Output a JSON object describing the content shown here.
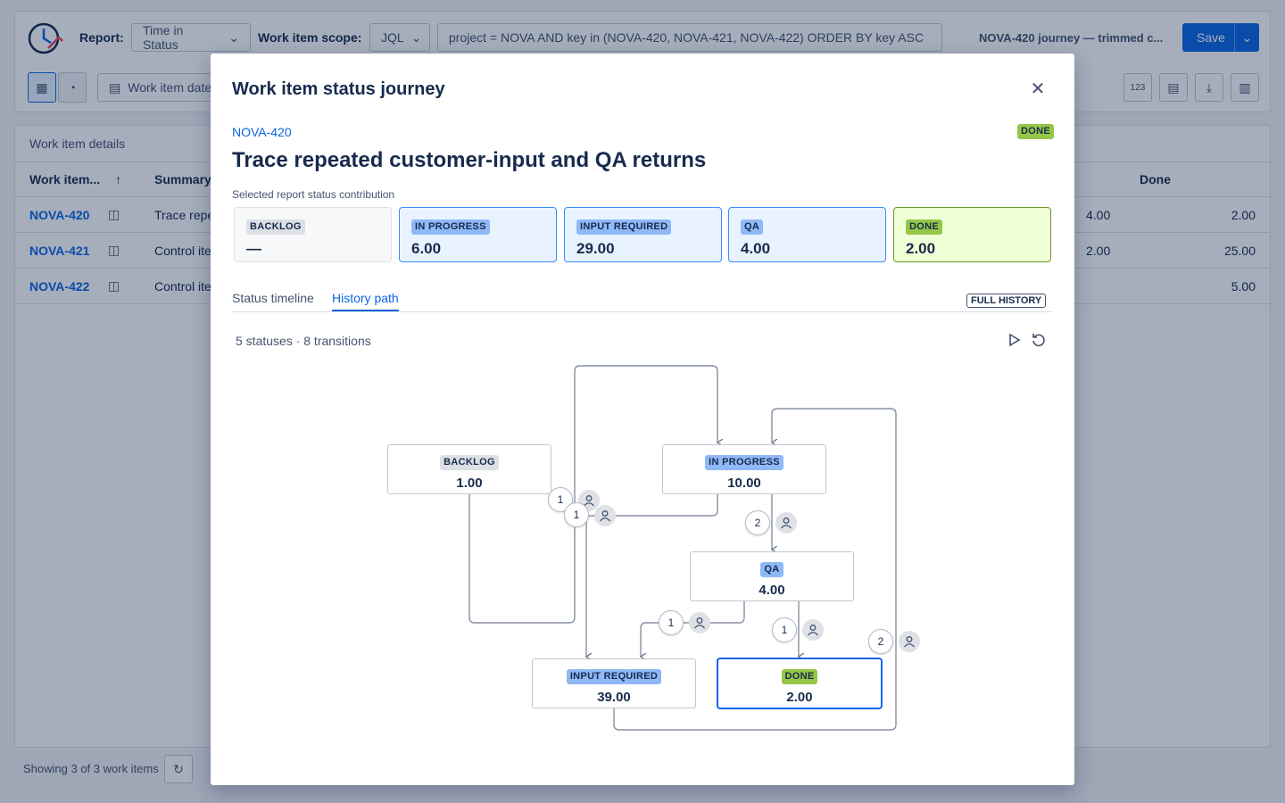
{
  "toolbar": {
    "report_label": "Report:",
    "report_value": "Time in Status",
    "scope_label": "Work item scope:",
    "scope_value": "JQL",
    "jql": "project = NOVA AND key in (NOVA-420, NOVA-421, NOVA-422) ORDER BY key ASC",
    "report_name": "NOVA-420 journey — trimmed c...",
    "save_label": "Save",
    "date_filter_label": "Work item date",
    "numbers_icon_label": "123"
  },
  "table": {
    "title": "Work item details",
    "col_key": "Work item...",
    "col_summary": "Summary",
    "col_done": "Done",
    "rows": [
      {
        "key": "NOVA-420",
        "summary": "Trace repe",
        "qa": "4.00",
        "done": "2.00"
      },
      {
        "key": "NOVA-421",
        "summary": "Control ite",
        "qa": "2.00",
        "done": "25.00"
      },
      {
        "key": "NOVA-422",
        "summary": "Control ite",
        "qa": "-",
        "done": "5.00"
      }
    ],
    "footer": "Showing 3 of 3 work items"
  },
  "modal": {
    "title": "Work item status journey",
    "key": "NOVA-420",
    "status": "DONE",
    "summary": "Trace repeated customer-input and QA returns",
    "contrib_label": "Selected report status contribution",
    "contrib": [
      {
        "name": "BACKLOG",
        "value": "—"
      },
      {
        "name": "IN PROGRESS",
        "value": "6.00"
      },
      {
        "name": "INPUT REQUIRED",
        "value": "29.00"
      },
      {
        "name": "QA",
        "value": "4.00"
      },
      {
        "name": "DONE",
        "value": "2.00"
      }
    ],
    "tabs": [
      "Status timeline",
      "History path"
    ],
    "full_history": "FULL HISTORY",
    "summary_counts": "5 statuses · 8 transitions",
    "nodes": [
      {
        "name": "BACKLOG",
        "value": "1.00"
      },
      {
        "name": "IN PROGRESS",
        "value": "10.00"
      },
      {
        "name": "QA",
        "value": "4.00"
      },
      {
        "name": "INPUT REQUIRED",
        "value": "39.00"
      },
      {
        "name": "DONE",
        "value": "2.00"
      }
    ],
    "transitions": [
      "1",
      "1",
      "2",
      "1",
      "1",
      "2"
    ]
  },
  "colors": {
    "accent": "#0c66e4",
    "done": "#94c748",
    "progress": "#8fb8f6"
  }
}
